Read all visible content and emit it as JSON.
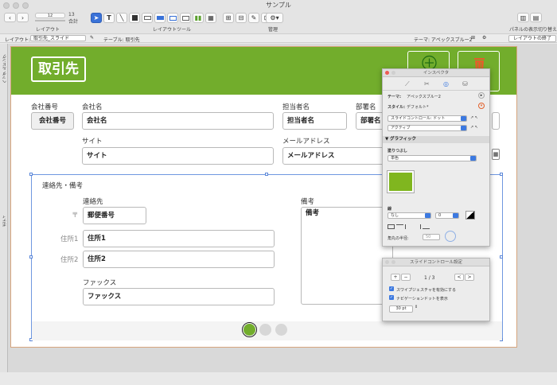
{
  "window": {
    "title": "サンプル"
  },
  "toolbar": {
    "zoom_value": "12",
    "count_value": "13",
    "count_label": "合計",
    "layout_label": "レイアウト",
    "tools_label": "レイアウトツール",
    "manage_label": "管理",
    "panel_label": "パネルの表示切り替え"
  },
  "layoutbar": {
    "layout_label": "レイアウト:",
    "layout_value": "取引先_スライド",
    "table_label": "テーブル: 取引先",
    "theme_label": "テーマ: アペックスブルー2",
    "exit_button": "レイアウトの終了"
  },
  "sidebar": {
    "top_text": "ヘッダ ルビング",
    "bottom_text": "ボディ"
  },
  "header": {
    "title": "取引先",
    "add_icon": "add-circle-icon",
    "delete_icon": "trash-icon",
    "color": "#72ad2c"
  },
  "fields": {
    "company_no_label": "会社番号",
    "company_no": "会社番号",
    "company_name_label": "会社名",
    "company_name": "会社名",
    "contact_label": "担当者名",
    "contact": "担当者名",
    "dept_label": "部署名",
    "dept": "部署名",
    "site_label": "サイト",
    "site": "サイト",
    "email_label": "メールアドレス",
    "email": "メールアドレス"
  },
  "tab": {
    "title": "連絡先・備考",
    "contact_section": "連絡先",
    "postal_prefix": "〒",
    "postal": "郵便番号",
    "addr1_label": "住所1",
    "addr1": "住所1",
    "addr2_label": "住所2",
    "addr2": "住所2",
    "fax_label": "ファックス",
    "fax": "ファックス",
    "notes_label": "備考",
    "notes": "備考"
  },
  "slider_dots": {
    "count": 3,
    "active_index": 0,
    "active_color": "#72ad2c"
  },
  "inspector": {
    "title": "インスペクタ",
    "theme_label": "テーマ:",
    "theme_value": "アペックスブルー2",
    "style_label": "スタイル:",
    "style_value": "デフォルト*",
    "object_select": "スライドコントロール: ドット",
    "state_select": "アクティブ",
    "graphic_section": "▼ グラフィック",
    "fill_label": "塗りつぶし",
    "fill_select": "単色",
    "fill_color": "#80b61f",
    "line_label": "線",
    "line_select": "なし",
    "line_width": "0",
    "radius_label": "角丸の半径:",
    "radius_value": "50"
  },
  "slide_panel": {
    "title": "スライドコントロール設定",
    "add": "+",
    "remove": "−",
    "page": "1 / 3",
    "prev": "<",
    "next": ">",
    "swipe_label": "スワイプジェスチャを有効にする",
    "dots_label": "ナビゲーションドットを表示",
    "size_value": "30 pt"
  }
}
